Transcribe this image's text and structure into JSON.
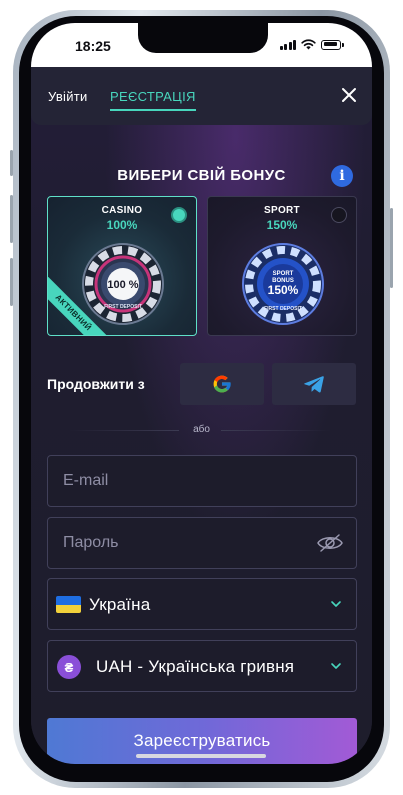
{
  "status_bar": {
    "time": "18:25"
  },
  "header": {
    "tabs": [
      {
        "label": "Увійти",
        "active": false
      },
      {
        "label": "РЕЄСТРАЦІЯ",
        "active": true
      }
    ]
  },
  "bonus": {
    "title": "ВИБЕРИ СВІЙ БОНУС",
    "cards": [
      {
        "label": "CASINO",
        "percent": "100%",
        "selected": true,
        "badge": "АКТИВНИЙ",
        "chip_text": "100 %",
        "chip_subtext": "FIRST DEPOSIT"
      },
      {
        "label": "SPORT",
        "percent": "150%",
        "selected": false,
        "chip_top": "SPORT",
        "chip_mid": "BONUS",
        "chip_text": "150%",
        "chip_subtext": "FIRST DEPOSIT"
      }
    ]
  },
  "social": {
    "continue_label": "Продовжити з",
    "buttons": [
      "google-icon",
      "telegram-icon"
    ]
  },
  "divider": {
    "text": "або"
  },
  "form": {
    "email_placeholder": "E-mail",
    "password_placeholder": "Пароль",
    "country": "Україна",
    "currency": "UAH - Українська гривня",
    "currency_symbol": "₴"
  },
  "register": {
    "label": "Зареєструватись"
  },
  "colors": {
    "accent": "#48d6bd",
    "button_gradient_start": "#4f79d4",
    "button_gradient_end": "#a25ad6",
    "background": "#1e1d2c"
  }
}
